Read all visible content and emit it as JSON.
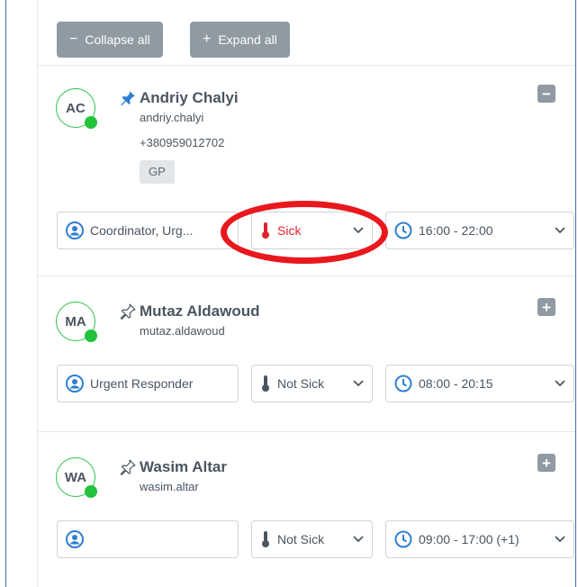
{
  "toolbar": {
    "collapse_label": "Collapse all",
    "collapse_symbol": "−",
    "expand_label": "Expand all",
    "expand_symbol": "+"
  },
  "people": [
    {
      "initials": "AC",
      "name": "Andriy Chalyi",
      "username": "andriy.chalyi",
      "phone": "+380959012702",
      "tag": "GP",
      "pinned": true,
      "expanded": true,
      "toggle_symbol": "−",
      "role": "Coordinator, Urg...",
      "sick_status": "Sick",
      "shift": "16:00 - 22:00",
      "status_color": "#22c23a"
    },
    {
      "initials": "MA",
      "name": "Mutaz Aldawoud",
      "username": "mutaz.aldawoud",
      "pinned": false,
      "expanded": false,
      "toggle_symbol": "+",
      "role": "Urgent Responder",
      "sick_status": "Not Sick",
      "shift": "08:00 - 20:15",
      "status_color": "#22c23a"
    },
    {
      "initials": "WA",
      "name": "Wasim Altar",
      "username": "wasim.altar",
      "pinned": false,
      "expanded": false,
      "toggle_symbol": "+",
      "role": "",
      "sick_status": "Not Sick",
      "shift": "09:00 - 17:00 (+1)",
      "status_color": "#22c23a"
    }
  ],
  "colors": {
    "accent_red": "#e0242c",
    "highlight_ring": "#e8181d",
    "button_gray": "#8f9aa2",
    "online_green": "#22c23a"
  },
  "icons": {
    "pinned": "filled-pin-icon",
    "unpinned": "outline-pin-icon",
    "role": "user-circle-icon",
    "sickness": "thermometer-icon",
    "shift": "clock-icon",
    "dropdown": "chevron-down-icon"
  }
}
